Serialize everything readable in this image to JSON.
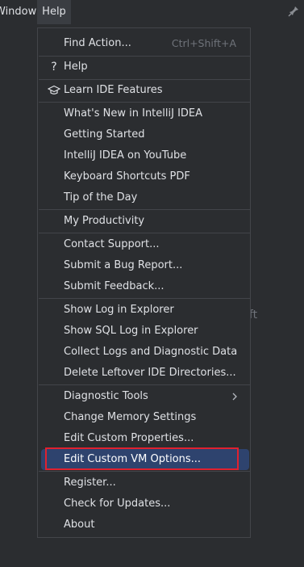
{
  "menubar": {
    "window_label": "Window",
    "help_label": "Help"
  },
  "background_hint": "ift",
  "help_menu": {
    "items": [
      {
        "label": "Find Action...",
        "shortcut": "Ctrl+Shift+A"
      },
      {
        "label": "Help",
        "icon": "question-icon"
      },
      {
        "label": "Learn IDE Features",
        "icon": "graduation-cap-icon"
      },
      {
        "label": "What's New in IntelliJ IDEA"
      },
      {
        "label": "Getting Started"
      },
      {
        "label": "IntelliJ IDEA on YouTube"
      },
      {
        "label": "Keyboard Shortcuts PDF"
      },
      {
        "label": "Tip of the Day"
      },
      {
        "label": "My Productivity"
      },
      {
        "label": "Contact Support..."
      },
      {
        "label": "Submit a Bug Report..."
      },
      {
        "label": "Submit Feedback..."
      },
      {
        "label": "Show Log in Explorer"
      },
      {
        "label": "Show SQL Log in Explorer"
      },
      {
        "label": "Collect Logs and Diagnostic Data"
      },
      {
        "label": "Delete Leftover IDE Directories..."
      },
      {
        "label": "Diagnostic Tools",
        "submenu": true
      },
      {
        "label": "Change Memory Settings"
      },
      {
        "label": "Edit Custom Properties..."
      },
      {
        "label": "Edit Custom VM Options...",
        "selected": true
      },
      {
        "label": "Register..."
      },
      {
        "label": "Check for Updates..."
      },
      {
        "label": "About"
      }
    ]
  },
  "colors": {
    "background": "#2b2d30",
    "selection": "#2e436e",
    "annotation_box": "#e0212f"
  }
}
